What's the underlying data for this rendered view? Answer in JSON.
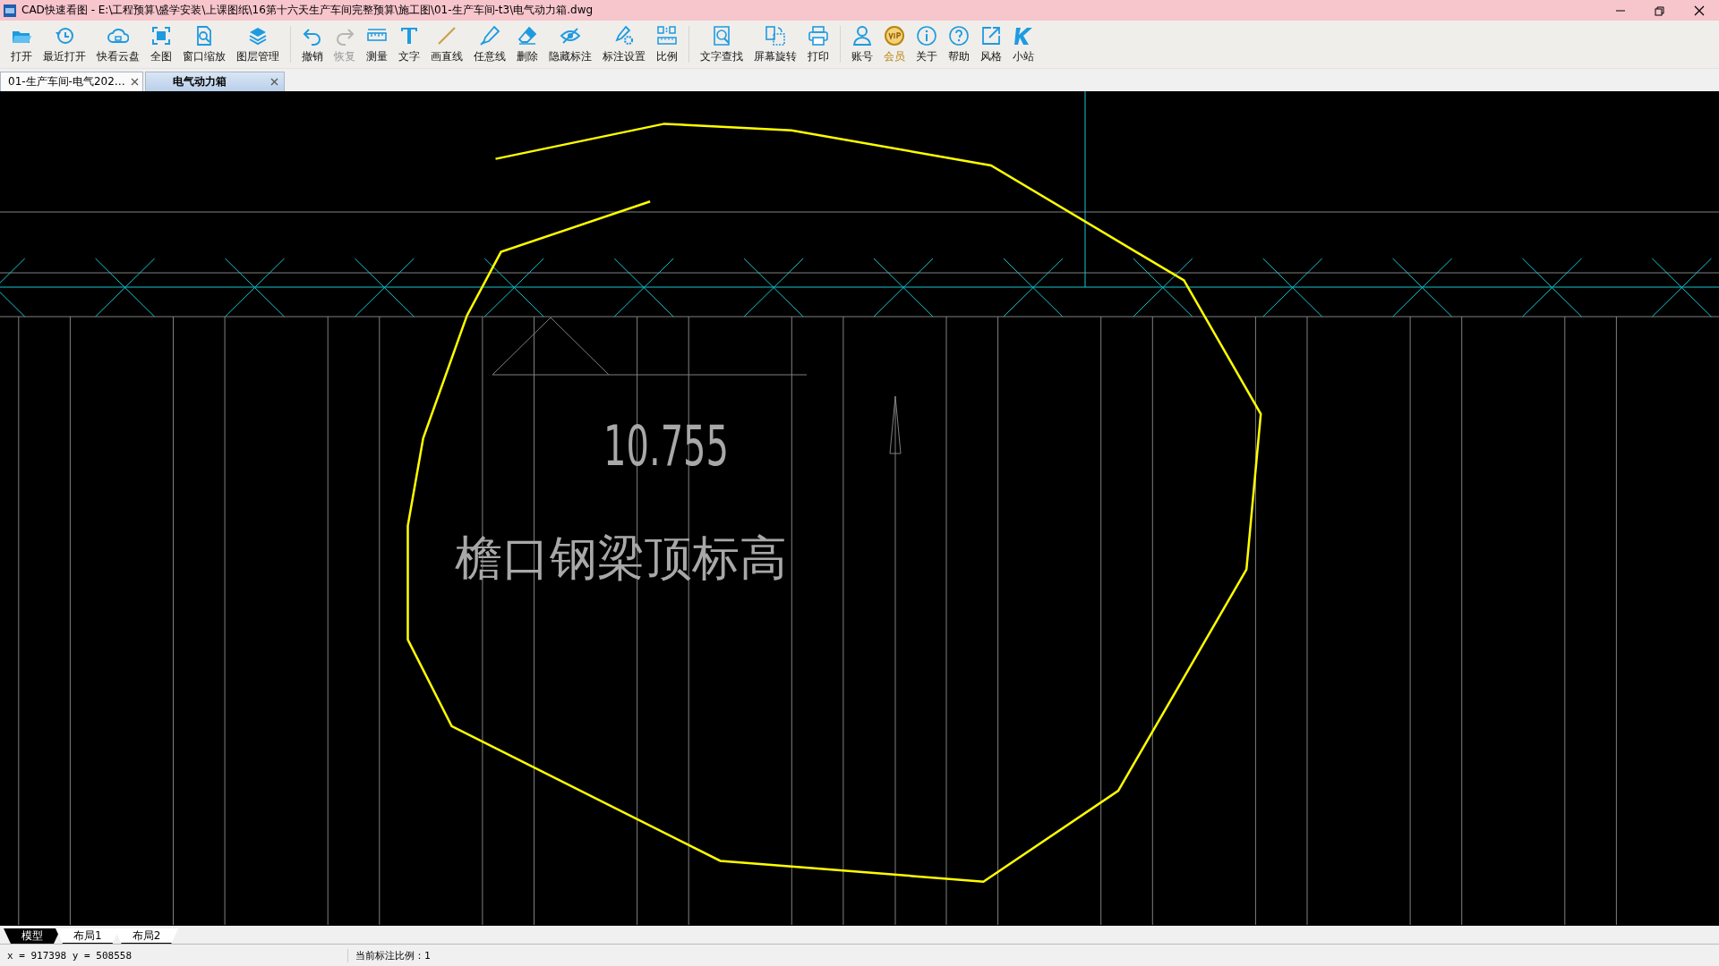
{
  "window": {
    "title": "CAD快速看图 - E:\\工程预算\\盛学安装\\上课图纸\\16第十六天生产车间完整预算\\施工图\\01-生产车间-t3\\电气动力箱.dwg"
  },
  "toolbar": {
    "groups": [
      [
        {
          "label": "打开",
          "kind": "folder",
          "disabled": false,
          "vip": false
        },
        {
          "label": "最近打开",
          "kind": "recent",
          "disabled": false,
          "vip": false
        },
        {
          "label": "快看云盘",
          "kind": "cloud",
          "disabled": false,
          "vip": false
        },
        {
          "label": "全图",
          "kind": "fit",
          "disabled": false,
          "vip": false
        },
        {
          "label": "窗口缩放",
          "kind": "zoom",
          "disabled": false,
          "vip": false
        },
        {
          "label": "图层管理",
          "kind": "layers",
          "disabled": false,
          "vip": false
        }
      ],
      [
        {
          "label": "撤销",
          "kind": "undo",
          "disabled": false,
          "vip": false
        },
        {
          "label": "恢复",
          "kind": "redo",
          "disabled": true,
          "vip": false
        },
        {
          "label": "测量",
          "kind": "ruler",
          "disabled": false,
          "vip": false
        },
        {
          "label": "文字",
          "kind": "text",
          "disabled": false,
          "vip": false
        },
        {
          "label": "画直线",
          "kind": "line",
          "disabled": false,
          "vip": false
        },
        {
          "label": "任意线",
          "kind": "pen",
          "disabled": false,
          "vip": false
        },
        {
          "label": "删除",
          "kind": "eraser",
          "disabled": false,
          "vip": false
        },
        {
          "label": "隐藏标注",
          "kind": "eye",
          "disabled": false,
          "vip": false
        },
        {
          "label": "标注设置",
          "kind": "pengear",
          "disabled": false,
          "vip": false
        },
        {
          "label": "比例",
          "kind": "scale",
          "disabled": false,
          "vip": false
        }
      ],
      [
        {
          "label": "文字查找",
          "kind": "find",
          "disabled": false,
          "vip": false
        },
        {
          "label": "屏幕旋转",
          "kind": "rotate",
          "disabled": false,
          "vip": false
        },
        {
          "label": "打印",
          "kind": "print",
          "disabled": false,
          "vip": false
        }
      ],
      [
        {
          "label": "账号",
          "kind": "user",
          "disabled": false,
          "vip": false
        },
        {
          "label": "会员",
          "kind": "vip",
          "disabled": false,
          "vip": true
        },
        {
          "label": "关于",
          "kind": "info",
          "disabled": false,
          "vip": false
        },
        {
          "label": "帮助",
          "kind": "help",
          "disabled": false,
          "vip": false
        },
        {
          "label": "风格",
          "kind": "style",
          "disabled": false,
          "vip": false
        },
        {
          "label": "小站",
          "kind": "k",
          "disabled": false,
          "vip": false
        }
      ]
    ]
  },
  "document_tabs": [
    {
      "label": "01-生产车间-电气202…",
      "selected": false
    },
    {
      "label": "电气动力箱",
      "selected": true
    }
  ],
  "drawing": {
    "texts": [
      {
        "kind": "elevation",
        "text": "10.755"
      },
      {
        "kind": "label",
        "text": "檐口钢梁顶标高"
      }
    ]
  },
  "layout_tabs": [
    {
      "label": "模型",
      "selected": true
    },
    {
      "label": "布局1",
      "selected": false
    },
    {
      "label": "布局2",
      "selected": false
    }
  ],
  "status_bar": {
    "coordinates": "x = 917398 y = 508558",
    "scale": "当前标注比例：1"
  }
}
